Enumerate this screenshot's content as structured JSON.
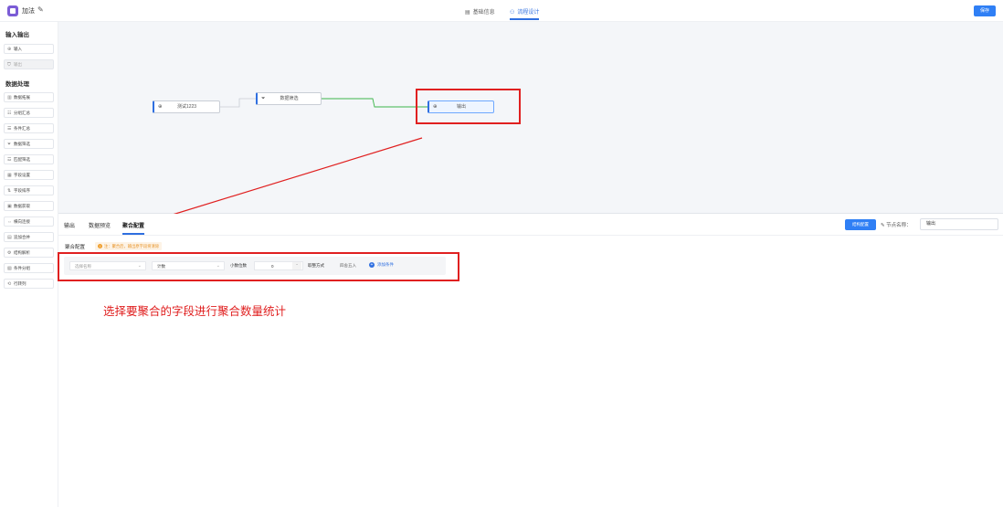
{
  "header": {
    "app_title": "加法",
    "tabs": [
      {
        "label": "基础信息",
        "icon": "document-icon"
      },
      {
        "label": "流程设计",
        "icon": "flow-icon"
      }
    ],
    "save_label": "保存"
  },
  "sidebar": {
    "section_io": "输入输出",
    "io_items": [
      {
        "label": "输入",
        "icon": "plus-circle-icon"
      },
      {
        "label": "输出",
        "icon": "shield-icon"
      }
    ],
    "section_processing": "数据处理",
    "processing_items": [
      {
        "label": "数据拓展",
        "icon": "layers-icon"
      },
      {
        "label": "分组汇总",
        "icon": "group-icon"
      },
      {
        "label": "条件汇总",
        "icon": "condition-icon"
      },
      {
        "label": "数据筛选",
        "icon": "filter-icon"
      },
      {
        "label": "匹配筛选",
        "icon": "match-icon"
      },
      {
        "label": "字段设置",
        "icon": "field-icon"
      },
      {
        "label": "字段排序",
        "icon": "sort-icon"
      },
      {
        "label": "数据获取",
        "icon": "fetch-icon"
      },
      {
        "label": "横向连接",
        "icon": "join-icon"
      },
      {
        "label": "追加合并",
        "icon": "append-icon"
      },
      {
        "label": "结构解析",
        "icon": "parse-icon"
      },
      {
        "label": "条件分组",
        "icon": "branch-icon"
      },
      {
        "label": "行转列",
        "icon": "pivot-icon"
      }
    ]
  },
  "canvas": {
    "nodes": [
      {
        "label": "测试1223",
        "icon": "plus-circle-icon"
      },
      {
        "label": "数据筛选",
        "icon": "filter-icon"
      },
      {
        "label": "输出",
        "icon": "plus-circle-icon"
      }
    ]
  },
  "panel": {
    "tabs": [
      "输出",
      "数据预览",
      "聚合配置"
    ],
    "structure_button": "结构配置",
    "node_name_label": "节点名称：",
    "node_name_value": "输出",
    "config_title": "聚合配置",
    "config_note": "注：聚合后，输出原字段将清除",
    "field_placeholder": "选择名称",
    "agg_value": "计数",
    "decimal_label": "小数位数",
    "decimal_value": "0",
    "rounding_label": "取整方式",
    "rounding_value": "四舍五入",
    "add_field_label": "添加条件"
  },
  "annotation": {
    "text": "选择要聚合的字段进行聚合数量统计",
    "color": "#e02020"
  },
  "colors": {
    "primary": "#2f7ff5",
    "annotation_red": "#e02020"
  }
}
